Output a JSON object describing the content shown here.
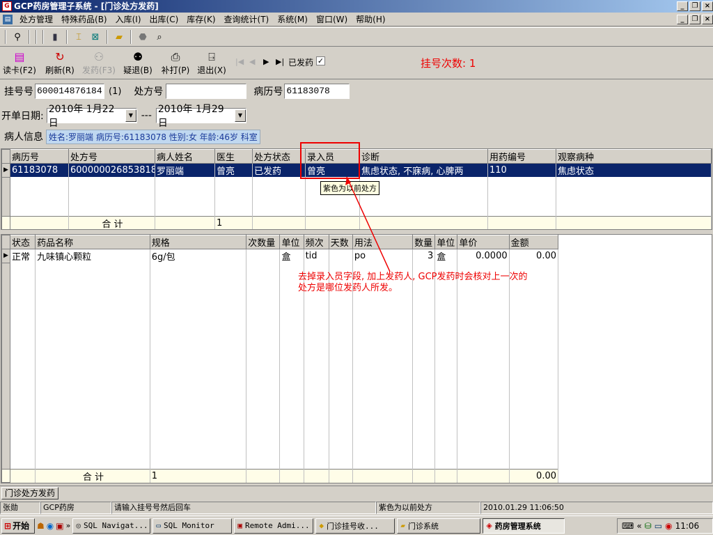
{
  "window": {
    "title": "GCP药房管理子系统 - [门诊处方发药]"
  },
  "menu": [
    "处方管理",
    "特殊药品(B)",
    "入库(I)",
    "出库(C)",
    "库存(K)",
    "查询统计(T)",
    "系统(M)",
    "窗口(W)",
    "帮助(H)"
  ],
  "toolbar2": {
    "read_card": "读卡(F2)",
    "refresh": "刷新(R)",
    "dispense": "发药(F3)",
    "return": "疑退(B)",
    "reprint": "补打(P)",
    "exit": "退出(X)",
    "dispensed_label": "已发药",
    "reg_count": "挂号次数: 1"
  },
  "form": {
    "reg_no_label": "挂号号",
    "reg_no": "600014876184",
    "reg_no_suffix": "(1)",
    "rx_no_label": "处方号",
    "rx_no": "",
    "record_no_label": "病历号",
    "record_no": "61183078",
    "date_label": "开单日期:",
    "date_from": "2010年 1月22日",
    "date_sep": "---",
    "date_to": "2010年 1月29日",
    "patient_label": "病人信息",
    "patient_info": "姓名:罗丽端 病历号:61183078 性别:女 年龄:46岁 科室"
  },
  "grid1": {
    "headers": [
      "病历号",
      "处方号",
      "病人姓名",
      "医生",
      "处方状态",
      "录入员",
      "诊断",
      "用药编号",
      "观察病种"
    ],
    "rows": [
      [
        "61183078",
        "600000026853818",
        "罗丽端",
        "曾亮",
        "已发药",
        "曾亮",
        "焦虑状态, 不寐病, 心脾两",
        "110",
        "焦虑状态"
      ]
    ],
    "sum_label": "合 计",
    "sum_value": "1"
  },
  "tooltip": "紫色为以前处方",
  "grid2": {
    "headers": [
      "状态",
      "药品名称",
      "规格",
      "次数量",
      "单位",
      "频次",
      "天数",
      "用法",
      "数量",
      "单位",
      "单价",
      "金额"
    ],
    "rows": [
      [
        "正常",
        "九味镇心颗粒",
        "6g/包",
        "",
        "盒",
        "tid",
        "",
        "po",
        "3",
        "盒",
        "0.0000",
        "0.00"
      ]
    ],
    "sum_label": "合 计",
    "sum_value": "1",
    "sum_amount": "0.00"
  },
  "annotation": "去掉录入员字段, 加上发药人, GCP发药时会核对上一次的处方是哪位发药人所发。",
  "tab": "门诊处方发药",
  "statusbar": [
    "张勋",
    "GCP药房",
    "请输入挂号号然后回车",
    "紫色为以前处方",
    "2010.01.29 11:06:50"
  ],
  "taskbar": {
    "start": "开始",
    "tasks": [
      "SQL Navigat...",
      "SQL Monitor",
      "Remote Admi...",
      "门诊挂号收...",
      "门诊系统",
      "药房管理系统"
    ],
    "clock": "11:06"
  },
  "colors": {
    "title_start": "#0a246a",
    "selection": "#0a246a",
    "annotation": "#e00000",
    "patient_bg": "#c0d8f0"
  }
}
